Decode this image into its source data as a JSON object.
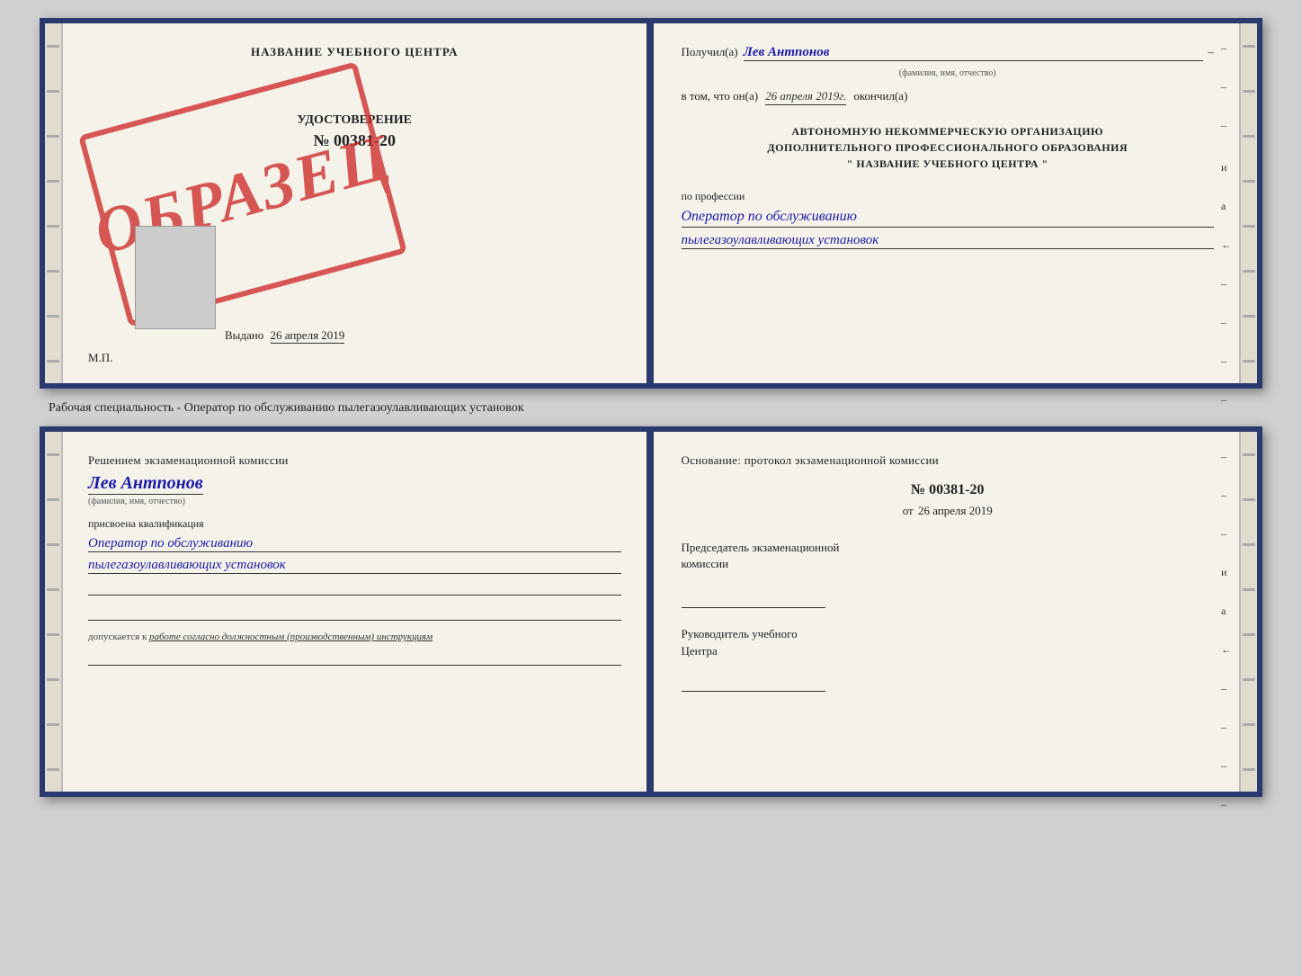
{
  "page": {
    "background": "#d0d0d0"
  },
  "topBook": {
    "leftPage": {
      "title": "НАЗВАНИЕ УЧЕБНОГО ЦЕНТРА",
      "certType": "УДОСТОВЕРЕНИЕ",
      "certNumber": "№ 00381-20",
      "issuedLabel": "Выдано",
      "issuedDate": "26 апреля 2019",
      "stampText": "ОБРАЗЕЦ",
      "mpLabel": "М.П."
    },
    "rightPage": {
      "receivedLabel": "Получил(а)",
      "personName": "Лев Антпонов",
      "fioSubtext": "(фамилия, имя, отчество)",
      "inThatLabel": "в том, что он(а)",
      "completedDate": "26 апреля 2019г.",
      "completedLabel": "окончил(а)",
      "orgLine1": "АВТОНОМНУЮ НЕКОММЕРЧЕСКУЮ ОРГАНИЗАЦИЮ",
      "orgLine2": "ДОПОЛНИТЕЛЬНОГО ПРОФЕССИОНАЛЬНОГО ОБРАЗОВАНИЯ",
      "orgLine3": "\"  НАЗВАНИЕ УЧЕБНОГО ЦЕНТРА  \"",
      "professionLabel": "по профессии",
      "professionLine1": "Оператор по обслуживанию",
      "professionLine2": "пылегазоулавливающих установок"
    }
  },
  "specialtyText": "Рабочая специальность - Оператор по обслуживанию пылегазоулавливающих установок",
  "bottomBook": {
    "leftPage": {
      "decisionText": "Решением экзаменационной комиссии",
      "personName": "Лев Антпонов",
      "fioSubtext": "(фамилия, имя, отчество)",
      "assignedLabel": "присвоена квалификация",
      "qualLine1": "Оператор по обслуживанию",
      "qualLine2": "пылегазоулавливающих установок",
      "allowedLabel": "допускается к",
      "allowedValue": "работе согласно должностным (производственным) инструкциям"
    },
    "rightPage": {
      "basisLabel": "Основание: протокол экзаменационной комиссии",
      "protocolNumber": "№ 00381-20",
      "protocolDatePrefix": "от",
      "protocolDate": "26 апреля 2019",
      "chairmanLine1": "Председатель экзаменационной",
      "chairmanLine2": "комиссии",
      "directorLine1": "Руководитель учебного",
      "directorLine2": "Центра"
    }
  }
}
